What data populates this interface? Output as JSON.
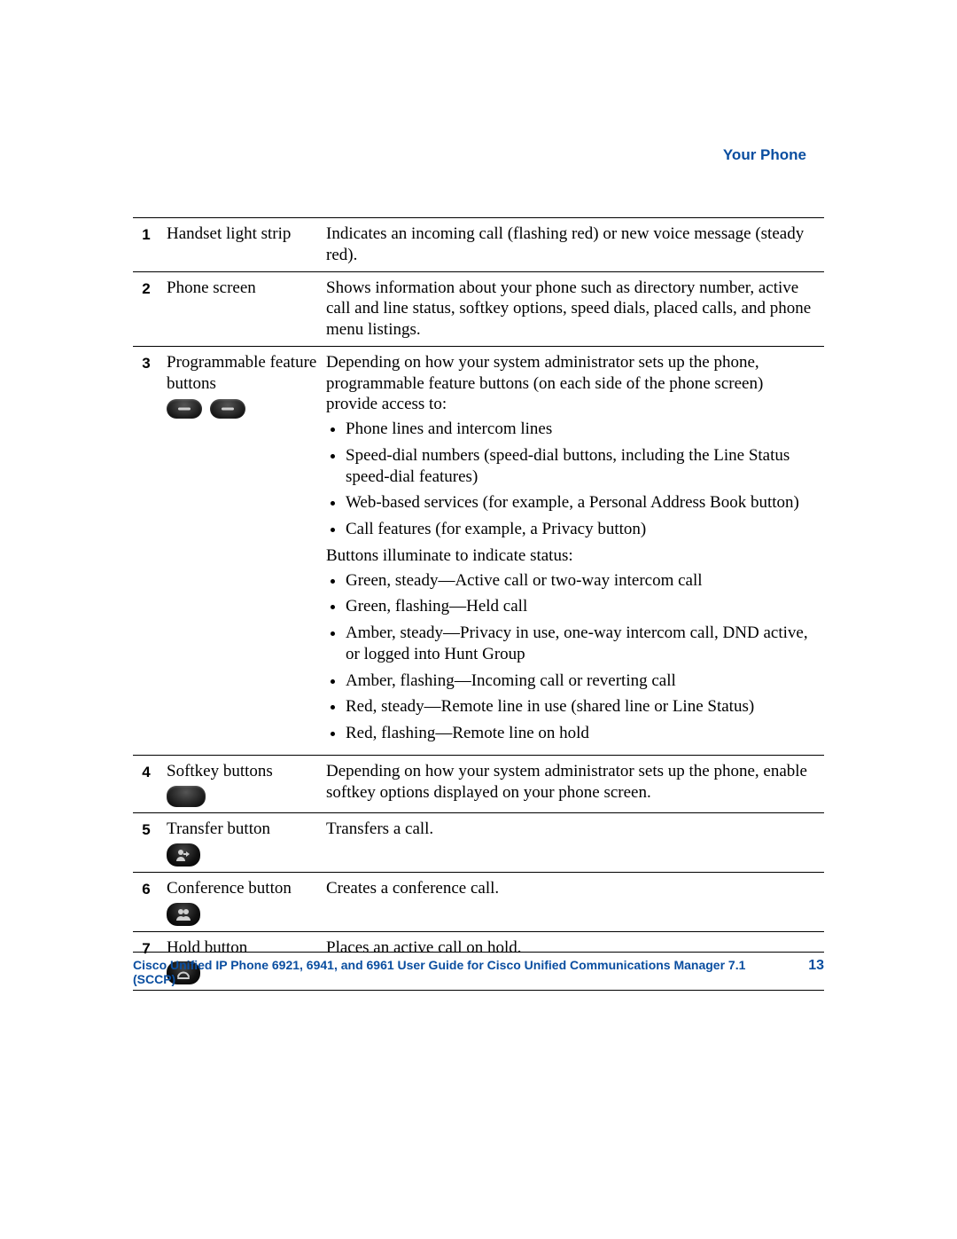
{
  "header": {
    "section": "Your Phone"
  },
  "rows": [
    {
      "num": "1",
      "name": "Handset light strip",
      "desc_plain": "Indicates an incoming call (flashing red) or new voice message (steady red)."
    },
    {
      "num": "2",
      "name": "Phone screen",
      "desc_plain": "Shows information about your phone such as directory number, active call and line status, softkey options, speed dials, placed calls, and phone menu listings."
    },
    {
      "num": "3",
      "name": "Programmable feature buttons",
      "desc": {
        "intro": "Depending on how your system administrator sets up the phone, programmable feature buttons (on each side of the phone screen) provide access to:",
        "list1": [
          "Phone lines and intercom lines",
          "Speed-dial numbers (speed-dial buttons, including the Line Status speed-dial features)",
          "Web-based services (for example, a Personal Address Book button)",
          "Call features (for example, a Privacy button)"
        ],
        "mid": "Buttons illuminate to indicate status:",
        "list2": [
          "Green, steady—Active call or two-way intercom call",
          "Green, flashing—Held call",
          "Amber, steady—Privacy in use, one-way intercom call, DND active, or logged into Hunt Group",
          "Amber, flashing—Incoming call or reverting call",
          "Red, steady—Remote line in use (shared line or Line Status)",
          "Red, flashing—Remote line on hold"
        ]
      }
    },
    {
      "num": "4",
      "name": "Softkey buttons",
      "desc_plain": "Depending on how your system administrator sets up the phone, enable softkey options displayed on your phone screen."
    },
    {
      "num": "5",
      "name": "Transfer button",
      "desc_plain": "Transfers a call."
    },
    {
      "num": "6",
      "name": "Conference button",
      "desc_plain": "Creates a conference call."
    },
    {
      "num": "7",
      "name": "Hold button",
      "desc_plain": "Places an active call on hold."
    }
  ],
  "footer": {
    "title": "Cisco Unified IP Phone 6921, 6941, and 6961 User Guide for Cisco Unified Communications Manager 7.1 (SCCP)",
    "page": "13"
  },
  "colors": {
    "accent": "#0a4ea0"
  }
}
